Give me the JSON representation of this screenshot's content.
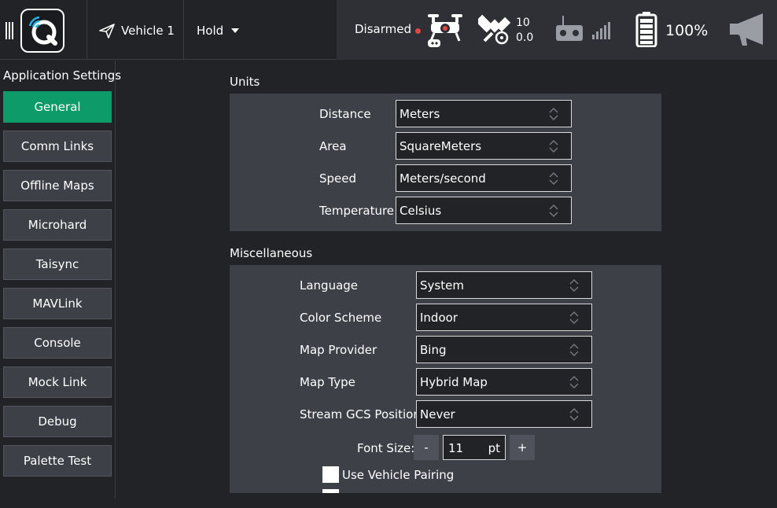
{
  "toolbar": {
    "vehicle_label": "Vehicle 1",
    "flight_mode": "Hold",
    "arm_status": "Disarmed",
    "gps_sat_count": "10",
    "gps_hdop": "0.0",
    "battery_percent": "100%",
    "colors": {
      "arm_dot": "#e0483d"
    },
    "icons": [
      "menu-bars-icon",
      "qgc-logo-icon",
      "paper-plane-icon",
      "drone-icon",
      "satellite-icon",
      "rc-transmitter-icon",
      "signal-bars-icon",
      "battery-icon",
      "megaphone-icon"
    ]
  },
  "sidebar": {
    "title": "Application Settings",
    "items": [
      {
        "label": "General",
        "active": true
      },
      {
        "label": "Comm Links"
      },
      {
        "label": "Offline Maps"
      },
      {
        "label": "Microhard"
      },
      {
        "label": "Taisync"
      },
      {
        "label": "MAVLink"
      },
      {
        "label": "Console"
      },
      {
        "label": "Mock Link"
      },
      {
        "label": "Debug"
      },
      {
        "label": "Palette Test"
      }
    ],
    "active_color": "#0e9b6a"
  },
  "units": {
    "title": "Units",
    "rows": [
      {
        "label": "Distance",
        "value": "Meters"
      },
      {
        "label": "Area",
        "value": "SquareMeters"
      },
      {
        "label": "Speed",
        "value": "Meters/second"
      },
      {
        "label": "Temperature",
        "value": "Celsius"
      }
    ]
  },
  "misc": {
    "title": "Miscellaneous",
    "rows": [
      {
        "label": "Language",
        "value": "System"
      },
      {
        "label": "Color Scheme",
        "value": "Indoor"
      },
      {
        "label": "Map Provider",
        "value": "Bing"
      },
      {
        "label": "Map Type",
        "value": "Hybrid Map"
      },
      {
        "label": "Stream GCS Position",
        "value": "Never"
      }
    ],
    "font_size": {
      "label": "Font Size:",
      "minus": "-",
      "value": "11",
      "unit": "pt",
      "plus": "+"
    },
    "vehicle_pairing_label": "Use Vehicle Pairing"
  }
}
